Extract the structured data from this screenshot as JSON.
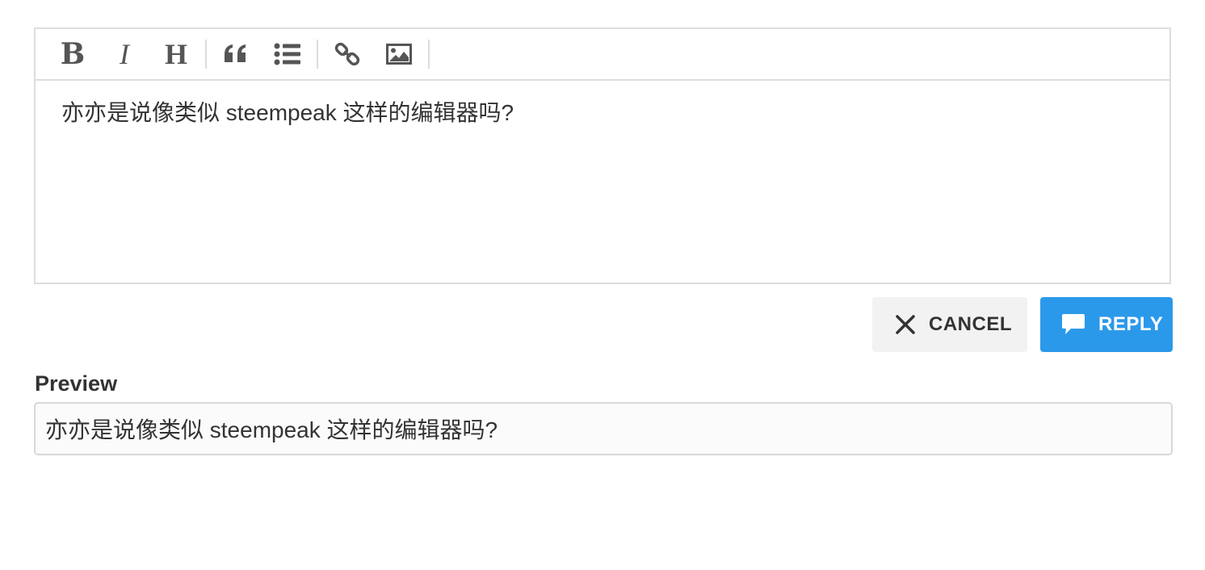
{
  "toolbar": {
    "bold_label": "B",
    "italic_label": "I",
    "heading_label": "H",
    "icons": [
      "bold-icon",
      "italic-icon",
      "heading-icon",
      "quote-icon",
      "list-icon",
      "link-icon",
      "image-icon"
    ]
  },
  "editor": {
    "value": "亦亦是说像类似 steempeak 这样的编辑器吗?"
  },
  "actions": {
    "cancel_label": "CANCEL",
    "reply_label": "REPLY",
    "reply_color": "#2b99ea",
    "cancel_bg": "#f2f2f2"
  },
  "preview": {
    "label": "Preview",
    "text": "亦亦是说像类似 steempeak 这样的编辑器吗?"
  }
}
